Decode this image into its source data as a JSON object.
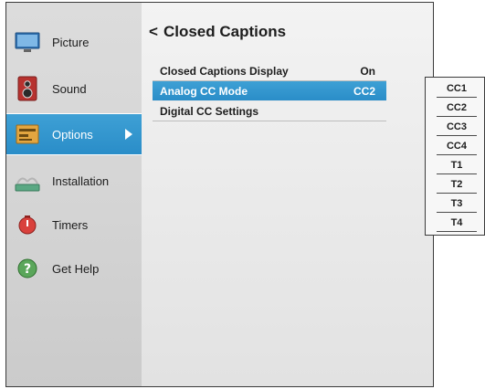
{
  "sidebar": {
    "items": [
      {
        "label": "Picture",
        "icon": "tv-icon"
      },
      {
        "label": "Sound",
        "icon": "speaker-icon"
      },
      {
        "label": "Options",
        "icon": "options-icon",
        "selected": true
      },
      {
        "label": "Installation",
        "icon": "installation-icon"
      },
      {
        "label": "Timers",
        "icon": "timer-icon"
      },
      {
        "label": "Get Help",
        "icon": "help-icon"
      }
    ]
  },
  "main": {
    "back_symbol": "<",
    "title": "Closed Captions",
    "rows": [
      {
        "label": "Closed Captions Display",
        "value": "On"
      },
      {
        "label": "Analog CC Mode",
        "value": "CC2",
        "selected": true
      },
      {
        "label": "Digital CC Settings",
        "value": ""
      }
    ]
  },
  "dropdown": {
    "options": [
      "CC1",
      "CC2",
      "CC3",
      "CC4",
      "T1",
      "T2",
      "T3",
      "T4"
    ]
  },
  "colors": {
    "accent": "#2a8dc8",
    "sidebar_bg": "#d6d6d6",
    "panel_bg": "#ececec"
  }
}
